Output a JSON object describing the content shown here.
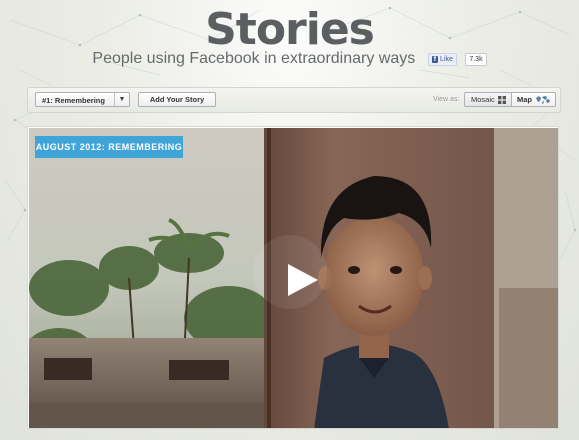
{
  "header": {
    "title": "Stories",
    "subtitle": "People using Facebook in extraordinary ways",
    "like_label": "Like",
    "like_count": "7.3k"
  },
  "toolbar": {
    "story_select": "#1: Remembering",
    "add_story_label": "Add Your Story",
    "view_as_label": "View as:",
    "mosaic_label": "Mosaic",
    "map_label": "Map"
  },
  "featured": {
    "badge": "AUGUST 2012: REMEMBERING",
    "play_icon": "play-icon"
  },
  "colors": {
    "badge_blue": "#3fa5d8",
    "facebook_blue": "#3b5998",
    "title_gray": "#5c5f61"
  }
}
